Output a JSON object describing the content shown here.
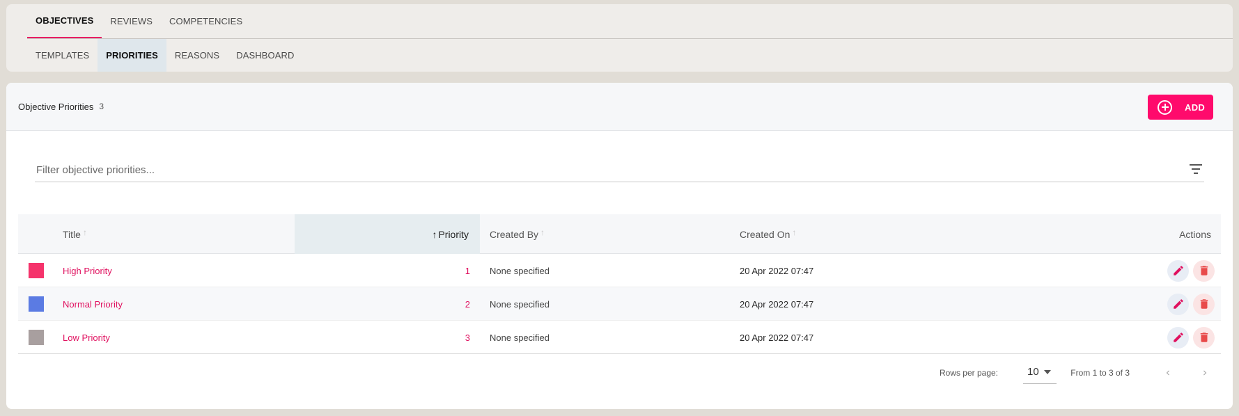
{
  "top_tabs": [
    {
      "label": "OBJECTIVES",
      "active": true
    },
    {
      "label": "REVIEWS",
      "active": false
    },
    {
      "label": "COMPETENCIES",
      "active": false
    }
  ],
  "sub_tabs": [
    {
      "label": "TEMPLATES",
      "active": false
    },
    {
      "label": "PRIORITIES",
      "active": true
    },
    {
      "label": "REASONS",
      "active": false
    },
    {
      "label": "DASHBOARD",
      "active": false
    }
  ],
  "card": {
    "title": "Objective Priorities",
    "count": "3",
    "add_label": "ADD"
  },
  "filter": {
    "placeholder": "Filter objective priorities...",
    "value": ""
  },
  "table": {
    "columns": {
      "title": "Title",
      "priority": "Priority",
      "created_by": "Created By",
      "created_on": "Created On",
      "actions": "Actions"
    },
    "sort_column": "priority",
    "rows": [
      {
        "color": "#f5336b",
        "title": "High Priority",
        "priority": "1",
        "created_by": "None specified",
        "created_on": "20 Apr 2022 07:47"
      },
      {
        "color": "#5b7be3",
        "title": "Normal Priority",
        "priority": "2",
        "created_by": "None specified",
        "created_on": "20 Apr 2022 07:47"
      },
      {
        "color": "#a89f9f",
        "title": "Low Priority",
        "priority": "3",
        "created_by": "None specified",
        "created_on": "20 Apr 2022 07:47"
      }
    ]
  },
  "pagination": {
    "rows_per_page_label": "Rows per page:",
    "rows_per_page": "10",
    "range_text": "From 1 to 3 of 3"
  },
  "colors": {
    "accent": "#ff0a6c",
    "link": "#e0115f"
  },
  "icons": {
    "add": "plus-circle-icon",
    "filter": "filter-lines-icon",
    "edit": "pencil-icon",
    "delete": "trash-icon",
    "prev": "chevron-left-icon",
    "next": "chevron-right-icon",
    "sort": "arrow-up-icon",
    "rpp_caret": "caret-down-icon"
  }
}
